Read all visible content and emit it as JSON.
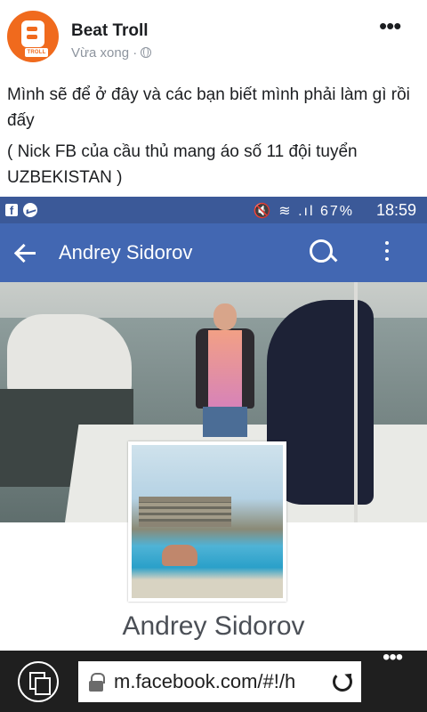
{
  "post": {
    "page_name": "Beat Troll",
    "time": "Vừa xong ·",
    "avatar_label": "TROLL",
    "more": "•••",
    "text_line1": "Mình sẽ để ở đây và các bạn biết mình phải làm gì rồi đấy",
    "text_line2": "( Nick FB của cầu thủ mang áo số 11 đội tuyển UZBEKISTAN )"
  },
  "screenshot": {
    "status_bar": {
      "icons": "🔇 ≋ .ıl",
      "battery": "67%",
      "time": "18:59"
    },
    "app_bar": {
      "title": "Andrey Sidorov"
    },
    "profile_name": "Andrey Sidorov"
  },
  "browser": {
    "url": "m.facebook.com/#!/h",
    "more": "•••"
  },
  "colors": {
    "facebook_blue": "#4267b2",
    "status_blue": "#3b5998",
    "avatar_orange": "#f06a1d",
    "browser_bar": "#1f1f1f"
  }
}
